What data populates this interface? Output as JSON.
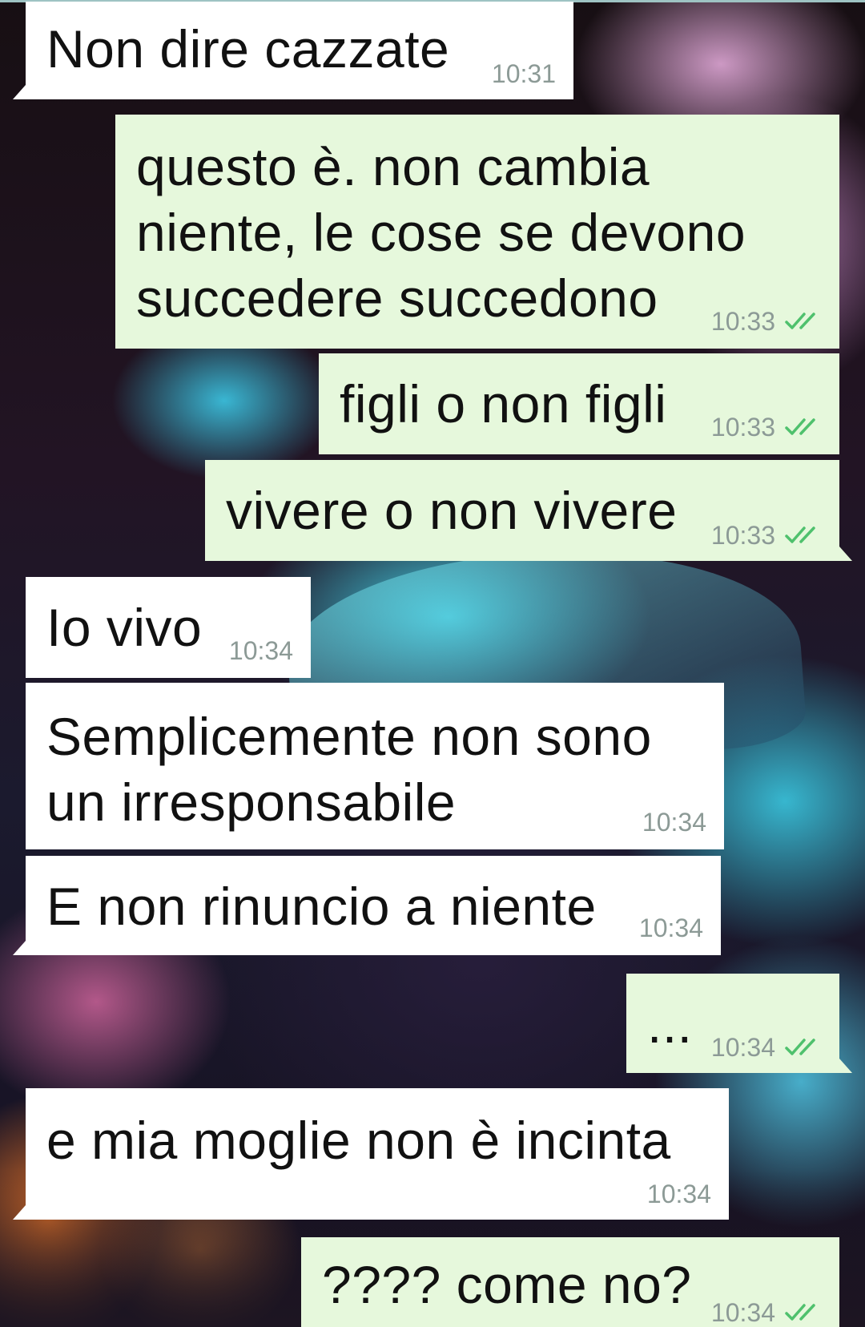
{
  "chat": {
    "messages": [
      {
        "direction": "in",
        "lines": [
          "Non dire cazzate"
        ],
        "time": "10:31"
      },
      {
        "direction": "out",
        "lines": [
          "questo è. non cambia",
          "niente, le cose se devono",
          "succedere succedono"
        ],
        "time": "10:33",
        "status": "read"
      },
      {
        "direction": "out",
        "lines": [
          "figli o non figli"
        ],
        "time": "10:33",
        "status": "read"
      },
      {
        "direction": "out",
        "lines": [
          "vivere o non vivere"
        ],
        "time": "10:33",
        "status": "read"
      },
      {
        "direction": "in",
        "lines": [
          "Io vivo"
        ],
        "time": "10:34"
      },
      {
        "direction": "in",
        "lines": [
          "Semplicemente non sono",
          "un irresponsabile"
        ],
        "time": "10:34"
      },
      {
        "direction": "in",
        "lines": [
          "E non rinuncio a niente"
        ],
        "time": "10:34"
      },
      {
        "direction": "out",
        "lines": [
          "..."
        ],
        "time": "10:34",
        "status": "read"
      },
      {
        "direction": "in",
        "lines": [
          "e mia moglie non è incinta"
        ],
        "time": "10:34"
      },
      {
        "direction": "out",
        "lines": [
          "???? come no?"
        ],
        "time": "10:34",
        "status": "read"
      }
    ]
  },
  "colors": {
    "incoming_bubble": "#ffffff",
    "outgoing_bubble": "#e6f8dc",
    "timestamp": "#8c9a96",
    "read_check": "#4fc16d"
  },
  "icons": {
    "read_receipt": "double-check-icon"
  }
}
